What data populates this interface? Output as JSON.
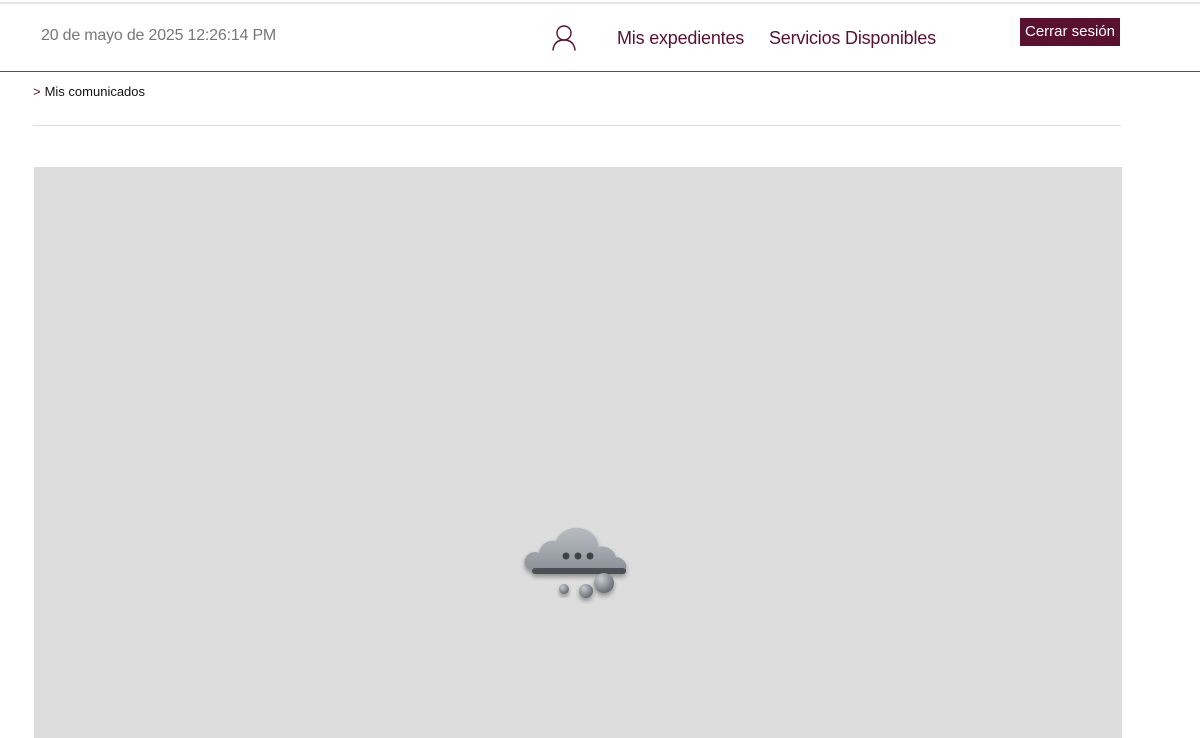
{
  "header": {
    "datetime": "20 de mayo de 2025 12:26:14 PM",
    "user_icon": "user-icon",
    "nav": {
      "expedientes": "Mis expedientes",
      "servicios": "Servicios Disponibles"
    },
    "logout_label": "Cerrar sesión"
  },
  "breadcrumb": {
    "separator": ">",
    "current": "Mis comunicados"
  },
  "content": {
    "loading_icon": "cloud-loading-icon"
  },
  "colors": {
    "brand": "#5a1030",
    "header_border": "#7a3d56",
    "panel_background": "#dddddd",
    "datetime_text": "#777777"
  }
}
